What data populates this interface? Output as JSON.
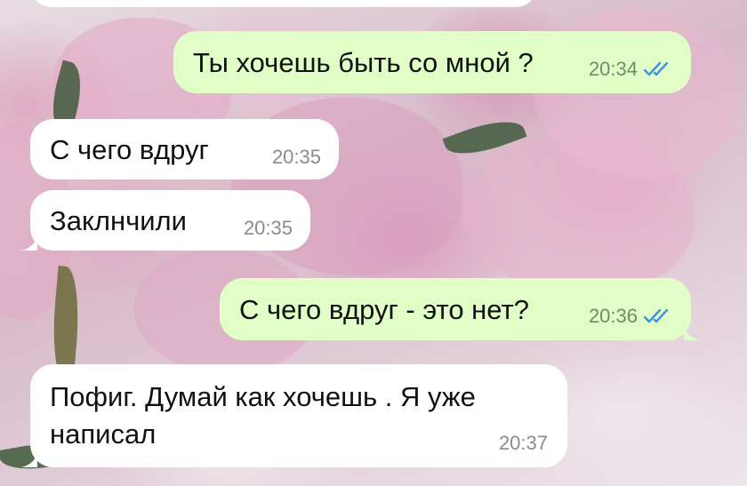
{
  "chat": {
    "colors": {
      "outgoing_bubble": "#e1fec6",
      "incoming_bubble": "#ffffff",
      "read_ticks": "#3b94e0"
    },
    "messages": [
      {
        "direction": "incoming",
        "text": "",
        "time": ""
      },
      {
        "direction": "outgoing",
        "text": "Ты хочешь быть со мной ?",
        "time": "20:34",
        "status": "read"
      },
      {
        "direction": "incoming",
        "text": "С чего вдруг",
        "time": "20:35"
      },
      {
        "direction": "incoming",
        "text": "Заклнчили",
        "time": "20:35"
      },
      {
        "direction": "outgoing",
        "text": "С чего вдруг - это нет?",
        "time": "20:36",
        "status": "read"
      },
      {
        "direction": "incoming",
        "text": "Пофиг. Думай как хочешь . Я уже\nнаписал",
        "time": "20:37"
      }
    ],
    "status_icon": "double-check-read-icon"
  }
}
